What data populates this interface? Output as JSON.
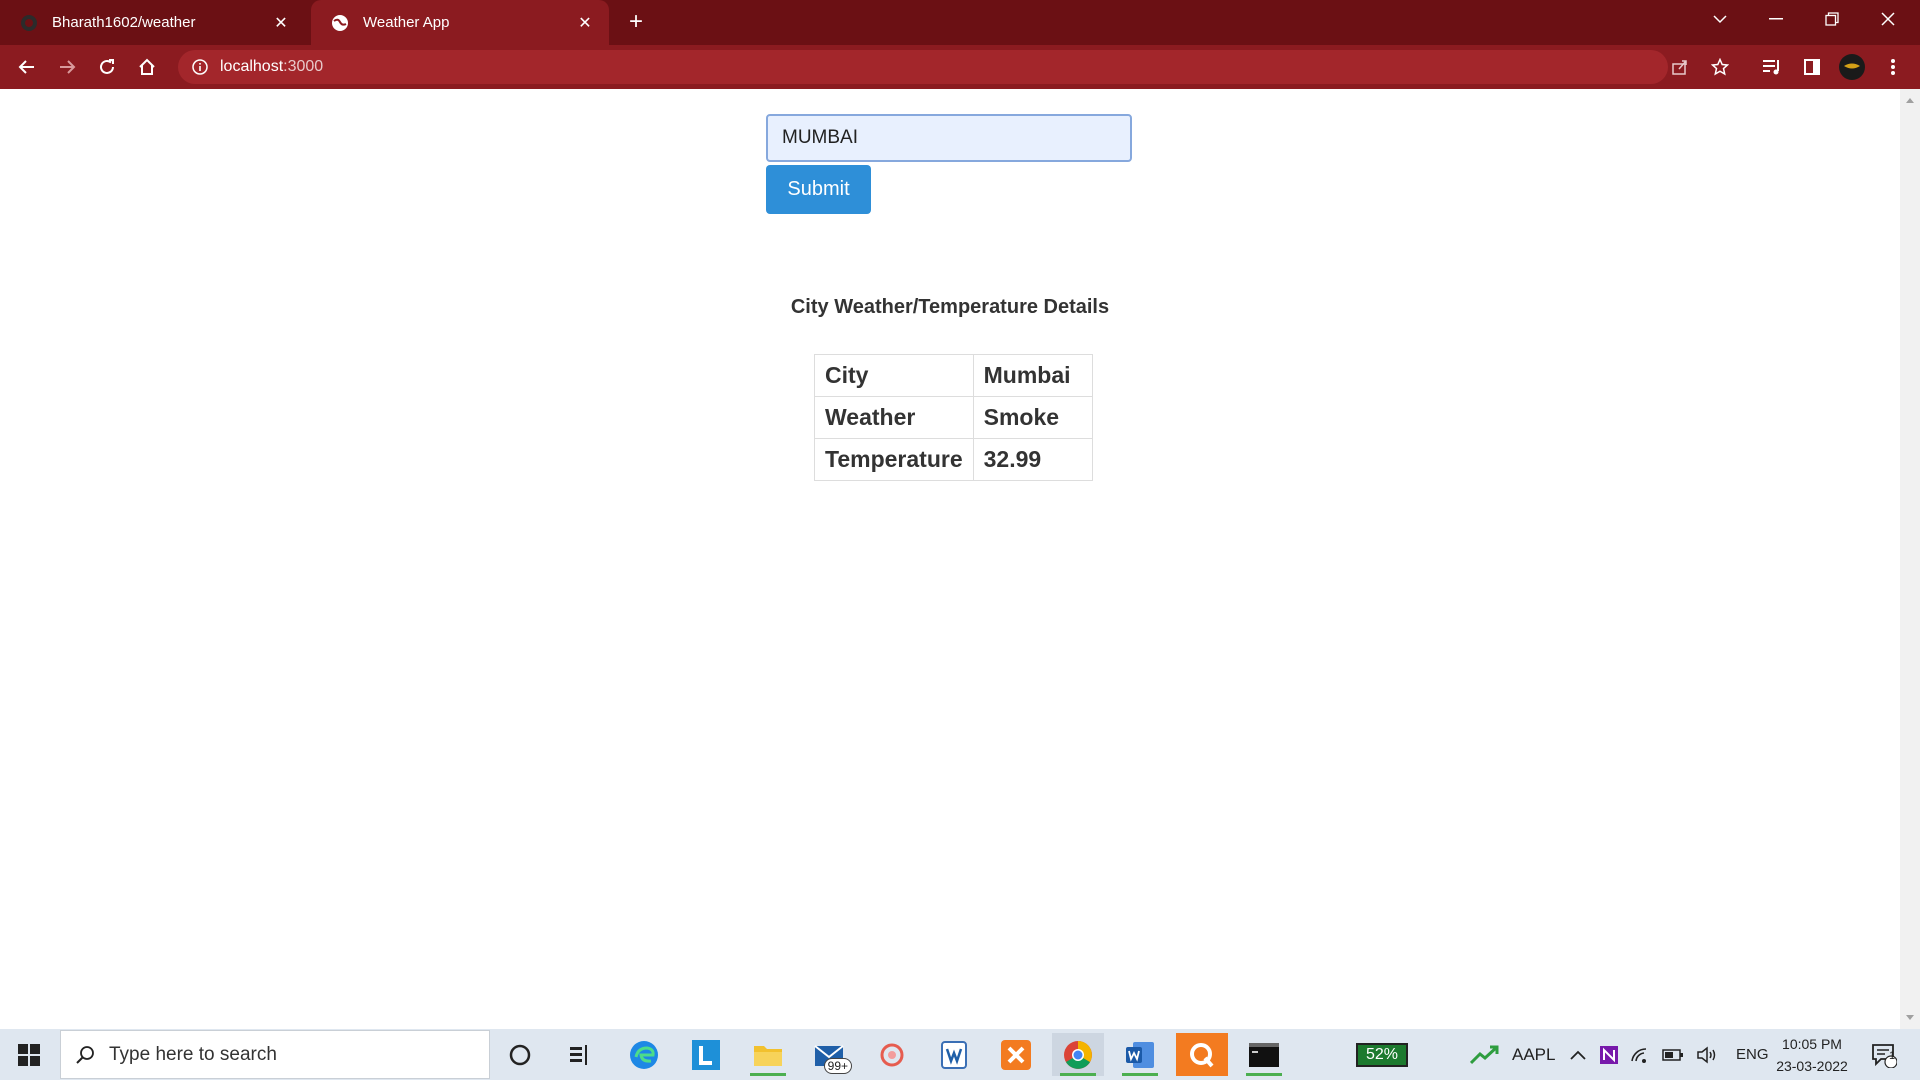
{
  "browser": {
    "tabs": [
      {
        "title": "Bharath1602/weather",
        "favicon": "github-icon",
        "active": false
      },
      {
        "title": "Weather App",
        "favicon": "globe-icon",
        "active": true
      }
    ],
    "address": {
      "host": "localhost",
      "port": ":3000"
    },
    "theme": {
      "frame": "#6b1014",
      "toolbar": "#8b1b20",
      "omnibox": "#a3262b"
    }
  },
  "form": {
    "city_value": "MUMBAI",
    "submit_label": "Submit"
  },
  "details": {
    "heading": "City Weather/Temperature Details",
    "rows": [
      {
        "label": "City",
        "value": "Mumbai"
      },
      {
        "label": "Weather",
        "value": "Smoke"
      },
      {
        "label": "Temperature",
        "value": "32.99"
      }
    ]
  },
  "taskbar": {
    "search_placeholder": "Type here to search",
    "mail_badge": "99+",
    "battery_widget": "52%",
    "stock_ticker": "AAPL",
    "language": "ENG",
    "time": "10:05 PM",
    "date": "23-03-2022",
    "notification_count": "1"
  }
}
